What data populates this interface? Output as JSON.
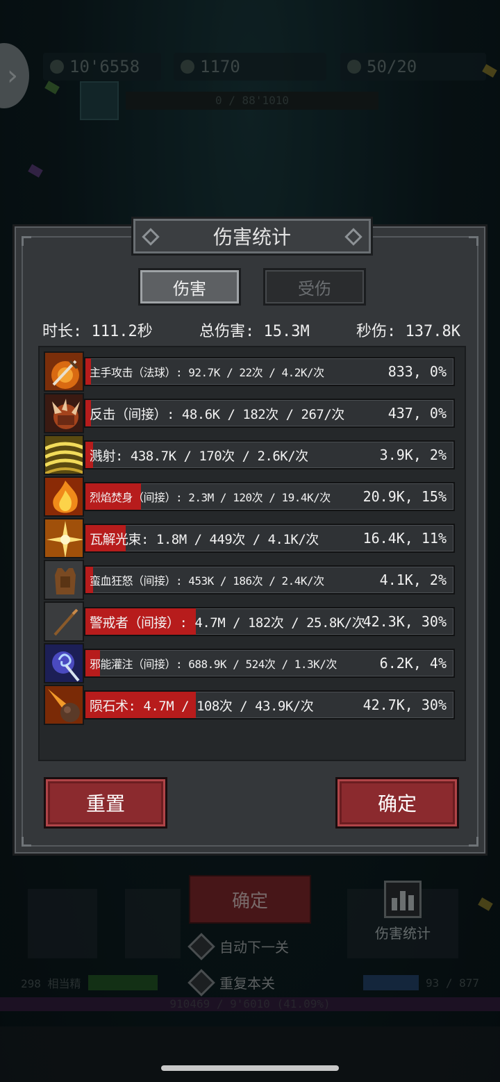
{
  "background": {
    "hud": {
      "gold": "10'6558",
      "gems": "1170",
      "energy": "50/20",
      "exp": "0 / 88'1010"
    },
    "confirm_label": "确定",
    "option_auto_next": "自动下一关",
    "option_repeat": "重复本关",
    "stats_button_label": "伤害统计",
    "bottom_bar_left": "298 相当精",
    "bottom_bar_right": "93 / 877",
    "xp_text": "910469 / 9'6010 (41.09%)"
  },
  "dialog": {
    "title": "伤害统计",
    "tabs": [
      {
        "label": "伤害",
        "active": true
      },
      {
        "label": "受伤",
        "active": false
      }
    ],
    "summary": {
      "duration": "时长: 111.2秒",
      "total_damage": "总伤害: 15.3M",
      "dps": "秒伤: 137.8K"
    },
    "rows": [
      {
        "text": "主手攻击（法球）: 92.7K / 22次 / 4.2K/次",
        "value": "833, 0%",
        "fill": 0.0,
        "icon": "sword-icon"
      },
      {
        "text": "反击（间接）: 48.6K / 182次 / 267/次",
        "value": "437, 0%",
        "fill": 0.0,
        "icon": "spiked-fist-icon"
      },
      {
        "text": "溅射: 438.7K / 170次 / 2.6K/次",
        "value": "3.9K, 2%",
        "fill": 0.02,
        "icon": "splash-wave-icon"
      },
      {
        "text": "烈焰焚身（间接）: 2.3M / 120次 / 19.4K/次",
        "value": "20.9K, 15%",
        "fill": 0.15,
        "icon": "flame-body-icon"
      },
      {
        "text": "瓦解光束: 1.8M / 449次 / 4.1K/次",
        "value": "16.4K, 11%",
        "fill": 0.11,
        "icon": "light-burst-icon"
      },
      {
        "text": "蛮血狂怒（间接）: 453K / 186次 / 2.4K/次",
        "value": "4.1K, 2%",
        "fill": 0.02,
        "icon": "armor-vest-icon"
      },
      {
        "text": "警戒者（间接）: 4.7M / 182次 / 25.8K/次",
        "value": "42.3K, 30%",
        "fill": 0.3,
        "icon": "wooden-staff-icon"
      },
      {
        "text": "邪能灌注（间接）: 688.9K / 524次 / 1.3K/次",
        "value": "6.2K, 4%",
        "fill": 0.04,
        "icon": "arcane-staff-icon"
      },
      {
        "text": "陨石术: 4.7M / 108次 / 43.9K/次",
        "value": "42.7K, 30%",
        "fill": 0.3,
        "icon": "meteor-icon"
      }
    ],
    "buttons": {
      "reset": "重置",
      "confirm": "确定"
    }
  },
  "colors": {
    "bar_fill": "#b71c1c",
    "button_red": "#8b2a2e",
    "panel": "#34373a"
  }
}
